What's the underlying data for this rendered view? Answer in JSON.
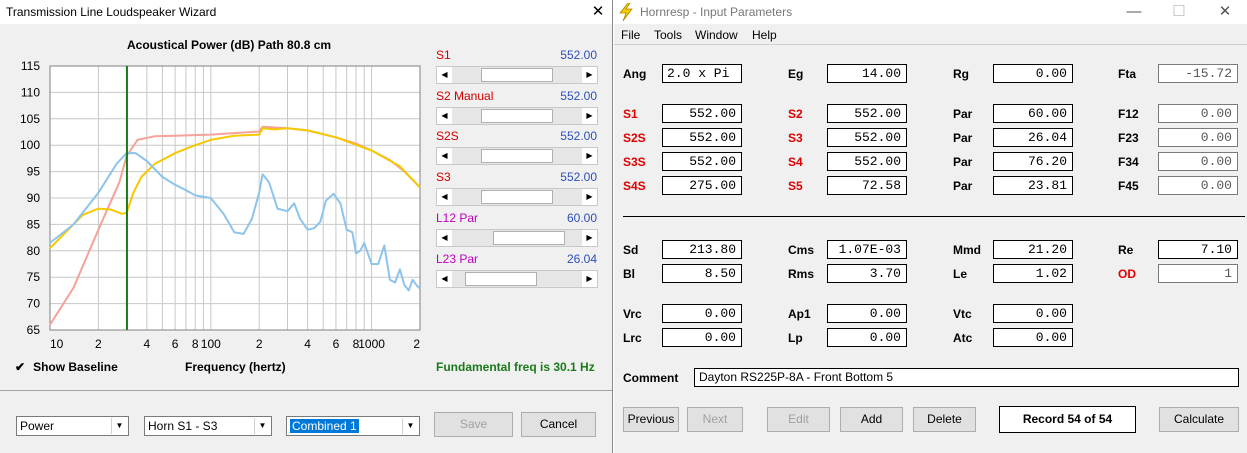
{
  "wizard": {
    "title": "Transmission Line Loudspeaker Wizard",
    "chart_title": "Acoustical Power (dB)   Path 80.8 cm",
    "y_ticks": [
      "115",
      "110",
      "105",
      "100",
      "95",
      "90",
      "85",
      "80",
      "75",
      "70",
      "65"
    ],
    "x_ticks": [
      "10",
      "2",
      "4",
      "6",
      "8",
      "100",
      "2",
      "4",
      "6",
      "8",
      "1000",
      "2"
    ],
    "x_label": "Frequency (hertz)",
    "show_baseline": "Show Baseline",
    "fundamental": "Fundamental freq is 30.1 Hz",
    "sliders": [
      {
        "label": "S1",
        "value": "552.00",
        "pos": 0.5
      },
      {
        "label": "S2  Manual",
        "value": "552.00",
        "pos": 0.5
      },
      {
        "label": "S2S",
        "value": "552.00",
        "pos": 0.5
      },
      {
        "label": "S3",
        "value": "552.00",
        "pos": 0.5
      },
      {
        "label": "L12  Par",
        "value": "60.00",
        "pos": 0.7
      },
      {
        "label": "L23  Par",
        "value": "26.04",
        "pos": 0.22
      }
    ],
    "combo_power": "Power",
    "combo_horn": "Horn S1 - S3",
    "combo_combined": "Combined 1",
    "save": "Save",
    "cancel": "Cancel",
    "colors": {
      "salmon": "#f4a29a",
      "yellow": "#f5c800",
      "blue": "#8cc4ec",
      "marker": "#1a7a1a",
      "label_red": "#d00000",
      "label_mag": "#c000c0",
      "value_blue": "#2d4fb6"
    }
  },
  "chart_data": {
    "type": "line",
    "title": "Acoustical Power (dB)   Path 80.8 cm",
    "xlabel": "Frequency (hertz)",
    "ylabel": "",
    "xscale": "log",
    "xlim": [
      10,
      2000
    ],
    "ylim": [
      65,
      115
    ],
    "marker_x": 30.1,
    "series": [
      {
        "color": "#f4a29a",
        "points": [
          [
            10,
            66
          ],
          [
            14,
            73
          ],
          [
            20,
            84
          ],
          [
            27,
            93
          ],
          [
            30,
            98
          ],
          [
            35,
            101
          ],
          [
            45,
            101.7
          ],
          [
            60,
            101.8
          ],
          [
            100,
            102
          ],
          [
            200,
            102.6
          ],
          [
            210,
            103.5
          ],
          [
            300,
            103.2
          ],
          [
            400,
            102.8
          ],
          [
            600,
            101.5
          ],
          [
            800,
            100.3
          ],
          [
            1000,
            99
          ],
          [
            1300,
            97.2
          ],
          [
            1600,
            95
          ],
          [
            2000,
            92
          ]
        ]
      },
      {
        "color": "#f5c800",
        "points": [
          [
            10,
            80.5
          ],
          [
            13,
            84
          ],
          [
            16,
            86.8
          ],
          [
            20,
            88
          ],
          [
            24,
            87.8
          ],
          [
            28,
            87
          ],
          [
            30,
            87.2
          ],
          [
            33,
            91
          ],
          [
            37,
            94
          ],
          [
            45,
            96.5
          ],
          [
            60,
            98.5
          ],
          [
            80,
            100
          ],
          [
            100,
            101
          ],
          [
            140,
            101.8
          ],
          [
            200,
            102
          ],
          [
            210,
            103.2
          ],
          [
            250,
            103
          ],
          [
            300,
            103.2
          ],
          [
            400,
            102.8
          ],
          [
            600,
            101.5
          ],
          [
            1000,
            99
          ],
          [
            1500,
            96
          ],
          [
            2000,
            92
          ]
        ]
      },
      {
        "color": "#8cc4ec",
        "points": [
          [
            10,
            81.5
          ],
          [
            14,
            85
          ],
          [
            20,
            91
          ],
          [
            26,
            96.5
          ],
          [
            30,
            98.5
          ],
          [
            34,
            98.5
          ],
          [
            40,
            97
          ],
          [
            50,
            94
          ],
          [
            60,
            92.5
          ],
          [
            70,
            91.5
          ],
          [
            80,
            90.5
          ],
          [
            100,
            90
          ],
          [
            120,
            87
          ],
          [
            140,
            83.5
          ],
          [
            160,
            83.2
          ],
          [
            180,
            86
          ],
          [
            200,
            91
          ],
          [
            210,
            94.5
          ],
          [
            230,
            93
          ],
          [
            260,
            88
          ],
          [
            300,
            87.5
          ],
          [
            330,
            89
          ],
          [
            360,
            86
          ],
          [
            400,
            84
          ],
          [
            440,
            84.3
          ],
          [
            480,
            85.5
          ],
          [
            520,
            89.5
          ],
          [
            580,
            90.8
          ],
          [
            640,
            89
          ],
          [
            700,
            84
          ],
          [
            760,
            83.5
          ],
          [
            800,
            79.5
          ],
          [
            850,
            80
          ],
          [
            900,
            81.5
          ],
          [
            1000,
            77.5
          ],
          [
            1100,
            77.5
          ],
          [
            1200,
            81
          ],
          [
            1300,
            74.5
          ],
          [
            1400,
            74
          ],
          [
            1500,
            76.5
          ],
          [
            1600,
            73.5
          ],
          [
            1700,
            72.5
          ],
          [
            1800,
            74.5
          ],
          [
            1900,
            73.5
          ],
          [
            2000,
            72.8
          ]
        ]
      }
    ]
  },
  "hornresp": {
    "title": "Hornresp - Input Parameters",
    "menu": [
      "File",
      "Tools",
      "Window",
      "Help"
    ],
    "rows": [
      {
        "cells": [
          {
            "label": "Ang",
            "value": "2.0 x Pi",
            "red": false,
            "left": true
          },
          {
            "label": "Eg",
            "value": "14.00",
            "red": false
          },
          {
            "label": "Rg",
            "value": "0.00",
            "red": false
          },
          {
            "label": "Fta",
            "value": "-15.72",
            "red": false,
            "ro": true
          }
        ]
      },
      {
        "cells": [
          {
            "label": "S1",
            "value": "552.00",
            "red": true
          },
          {
            "label": "S2",
            "value": "552.00",
            "red": true
          },
          {
            "label": "Par",
            "value": "60.00",
            "red": false
          },
          {
            "label": "F12",
            "value": "0.00",
            "red": false,
            "ro": true
          }
        ]
      },
      {
        "cells": [
          {
            "label": "S2S",
            "value": "552.00",
            "red": true
          },
          {
            "label": "S3",
            "value": "552.00",
            "red": true
          },
          {
            "label": "Par",
            "value": "26.04",
            "red": false
          },
          {
            "label": "F23",
            "value": "0.00",
            "red": false,
            "ro": true
          }
        ]
      },
      {
        "cells": [
          {
            "label": "S3S",
            "value": "552.00",
            "red": true
          },
          {
            "label": "S4",
            "value": "552.00",
            "red": true
          },
          {
            "label": "Par",
            "value": "76.20",
            "red": false
          },
          {
            "label": "F34",
            "value": "0.00",
            "red": false,
            "ro": true
          }
        ]
      },
      {
        "cells": [
          {
            "label": "S4S",
            "value": "275.00",
            "red": true
          },
          {
            "label": "S5",
            "value": "72.58",
            "red": true
          },
          {
            "label": "Par",
            "value": "23.81",
            "red": false
          },
          {
            "label": "F45",
            "value": "0.00",
            "red": false,
            "ro": true
          }
        ]
      },
      {
        "cells": [
          {
            "label": "Sd",
            "value": "213.80",
            "red": false
          },
          {
            "label": "Cms",
            "value": "1.07E-03",
            "red": false
          },
          {
            "label": "Mmd",
            "value": "21.20",
            "red": false
          },
          {
            "label": "Re",
            "value": "7.10",
            "red": false
          }
        ]
      },
      {
        "cells": [
          {
            "label": "Bl",
            "value": "8.50",
            "red": false
          },
          {
            "label": "Rms",
            "value": "3.70",
            "red": false
          },
          {
            "label": "Le",
            "value": "1.02",
            "red": false
          },
          {
            "label": "OD",
            "value": "1",
            "red": true,
            "ro": true
          }
        ]
      },
      {
        "cells": [
          {
            "label": "Vrc",
            "value": "0.00",
            "red": false
          },
          {
            "label": "Ap1",
            "value": "0.00",
            "red": false
          },
          {
            "label": "Vtc",
            "value": "0.00",
            "red": false
          }
        ]
      },
      {
        "cells": [
          {
            "label": "Lrc",
            "value": "0.00",
            "red": false
          },
          {
            "label": "Lp",
            "value": "0.00",
            "red": false
          },
          {
            "label": "Atc",
            "value": "0.00",
            "red": false
          }
        ]
      }
    ],
    "comment_label": "Comment",
    "comment": "Dayton RS225P-8A - Front Bottom 5",
    "buttons": {
      "previous": "Previous",
      "next": "Next",
      "edit": "Edit",
      "add": "Add",
      "delete": "Delete",
      "record": "Record 54 of 54",
      "calculate": "Calculate"
    }
  }
}
